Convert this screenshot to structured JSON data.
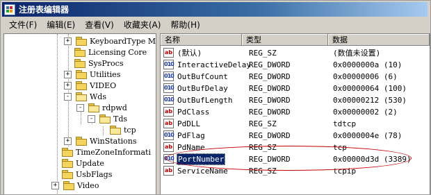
{
  "title": "注册表编辑器",
  "menu": [
    "文件(F)",
    "编辑(E)",
    "查看(V)",
    "收藏夹(A)",
    "帮助(H)"
  ],
  "tree": [
    {
      "label": "KeyboardType Ma",
      "expander": "+"
    },
    {
      "label": "Licensing Core",
      "expander": ""
    },
    {
      "label": "SysProcs",
      "expander": ""
    },
    {
      "label": "Utilities",
      "expander": "+"
    },
    {
      "label": "VIDEO",
      "expander": "+"
    },
    {
      "label": "Wds",
      "expander": "-"
    },
    {
      "label": "rdpwd",
      "expander": "-"
    },
    {
      "label": "Tds",
      "expander": "-"
    },
    {
      "label": "tcp",
      "expander": ""
    },
    {
      "label": "WinStations",
      "expander": "+"
    },
    {
      "label": "TimeZoneInformati",
      "expander": ""
    },
    {
      "label": "Update",
      "expander": ""
    },
    {
      "label": "UsbFlags",
      "expander": ""
    },
    {
      "label": "Video",
      "expander": "+"
    }
  ],
  "columns": {
    "name": "名称",
    "type": "类型",
    "data": "数据"
  },
  "values": [
    {
      "icon": "ab",
      "name": "(默认)",
      "type": "REG_SZ",
      "data": "(数值未设置)"
    },
    {
      "icon": "dword",
      "name": "InteractiveDelay",
      "type": "REG_DWORD",
      "data": "0x0000000a (10)"
    },
    {
      "icon": "dword",
      "name": "OutBufCount",
      "type": "REG_DWORD",
      "data": "0x00000006 (6)"
    },
    {
      "icon": "dword",
      "name": "OutBufDelay",
      "type": "REG_DWORD",
      "data": "0x00000064 (100)"
    },
    {
      "icon": "dword",
      "name": "OutBufLength",
      "type": "REG_DWORD",
      "data": "0x00000212 (530)"
    },
    {
      "icon": "ab",
      "name": "PdClass",
      "type": "REG_DWORD",
      "data": "0x00000002 (2)"
    },
    {
      "icon": "ab",
      "name": "PdDLL",
      "type": "REG_SZ",
      "data": "tdtcp"
    },
    {
      "icon": "dword",
      "name": "PdFlag",
      "type": "REG_DWORD",
      "data": "0x0000004e (78)"
    },
    {
      "icon": "ab",
      "name": "PdName",
      "type": "REG_SZ",
      "data": "tcp"
    },
    {
      "icon": "dword",
      "name": "PortNumber",
      "type": "REG_DWORD",
      "data": "0x00000d3d (3389)"
    },
    {
      "icon": "ab",
      "name": "ServiceName",
      "type": "REG_SZ",
      "data": "tcpip"
    }
  ],
  "selected_value": "PortNumber",
  "colors": {
    "title_start": "#0a246a",
    "selection": "#0a246a",
    "annotation": "#c00000"
  }
}
